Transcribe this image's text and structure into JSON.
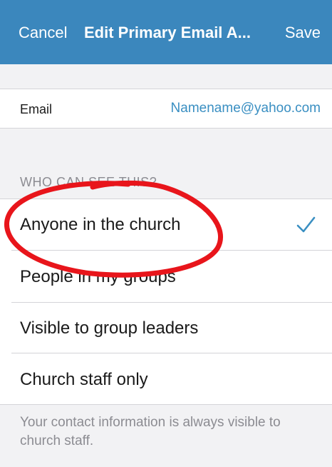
{
  "nav": {
    "cancel_label": "Cancel",
    "title": "Edit Primary Email A...",
    "save_label": "Save"
  },
  "email": {
    "label": "Email",
    "value": "Namename@yahoo.com"
  },
  "visibility": {
    "header": "WHO CAN SEE THIS?",
    "options": [
      {
        "label": "Anyone in the church",
        "selected": true
      },
      {
        "label": "People in my groups",
        "selected": false
      },
      {
        "label": "Visible to group leaders",
        "selected": false
      },
      {
        "label": "Church staff only",
        "selected": false
      }
    ],
    "footer": "Your contact information is always visible to church staff."
  },
  "colors": {
    "nav_bar": "#3b87bd",
    "accent": "#3a8fc2",
    "annotation": "#e8151b"
  },
  "icons": [
    "checkmark-icon"
  ]
}
